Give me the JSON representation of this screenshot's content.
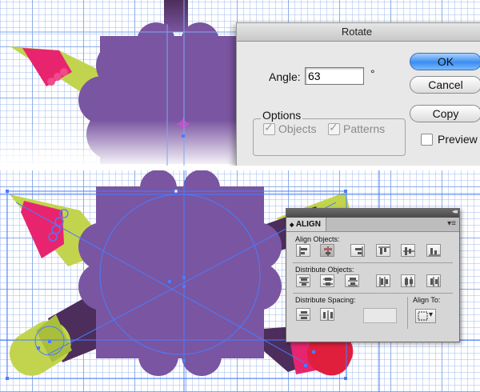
{
  "rotate_dialog": {
    "title": "Rotate",
    "angle_label": "Angle:",
    "angle_value": "63",
    "degree_symbol": "°",
    "options_legend": "Options",
    "objects_label": "Objects",
    "objects_checked": true,
    "patterns_label": "Patterns",
    "patterns_checked": true,
    "ok_label": "OK",
    "cancel_label": "Cancel",
    "copy_label": "Copy",
    "preview_label": "Preview",
    "preview_checked": false
  },
  "align_panel": {
    "collapse_glyph": "◂◂",
    "tab_arrow": "◆",
    "tab_label": "ALIGN",
    "menu_glyph": "▾≡",
    "align_objects_label": "Align Objects:",
    "distribute_objects_label": "Distribute Objects:",
    "distribute_spacing_label": "Distribute Spacing:",
    "align_to_label": "Align To:",
    "align_to_arrow": "▾",
    "align_icons": [
      "horizontal-align-left-icon",
      "horizontal-align-center-icon",
      "horizontal-align-right-icon",
      "vertical-align-top-icon",
      "vertical-align-center-icon",
      "vertical-align-bottom-icon"
    ],
    "distribute_icons": [
      "vertical-distribute-top-icon",
      "vertical-distribute-center-icon",
      "vertical-distribute-bottom-icon",
      "horizontal-distribute-left-icon",
      "horizontal-distribute-center-icon",
      "horizontal-distribute-right-icon"
    ],
    "spacing_icons": [
      "vertical-distribute-space-icon",
      "horizontal-distribute-space-icon"
    ],
    "active_align_index": 1
  },
  "colors": {
    "purple": "#7a55a1",
    "dark_purple": "#4d2d5c",
    "lime": "#c2d44e",
    "pink": "#e8246f",
    "selection_blue": "#4a7cff",
    "crosshair_magenta": "#d04fd8"
  }
}
